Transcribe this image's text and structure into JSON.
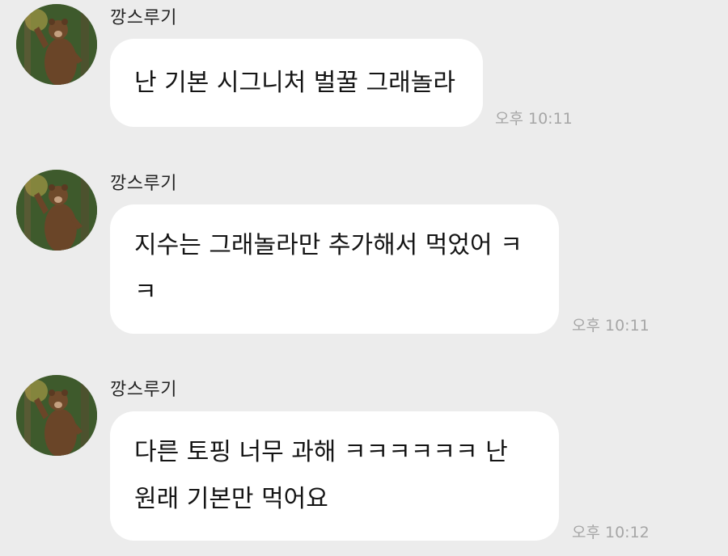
{
  "colors": {
    "background": "#ececec",
    "bubble": "#ffffff",
    "text": "#141414",
    "timestamp": "#a6a6a6"
  },
  "messages": [
    {
      "sender": "깡스루기",
      "avatar_icon": "bear-avatar-icon",
      "lines": [
        "난 기본 시그니처 벌꿀 그래놀라"
      ],
      "time": "오후 10:11"
    },
    {
      "sender": "깡스루기",
      "avatar_icon": "bear-avatar-icon",
      "lines": [
        "지수는 그래놀라만 추가해서 먹었어 ㅋ",
        "ㅋ"
      ],
      "time": "오후 10:11"
    },
    {
      "sender": "깡스루기",
      "avatar_icon": "bear-avatar-icon",
      "lines": [
        "다른 토핑 너무 과해 ㅋㅋㅋㅋㅋㅋ 난",
        "원래 기본만 먹어요"
      ],
      "time": "오후 10:12"
    }
  ]
}
